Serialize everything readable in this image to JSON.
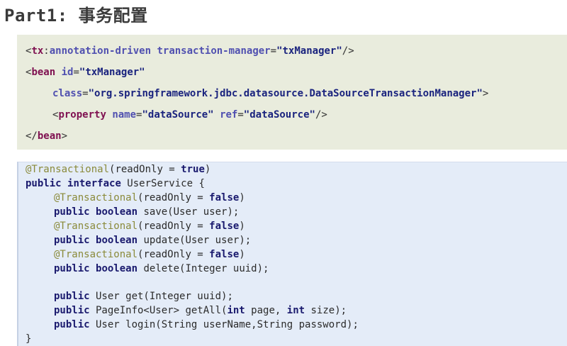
{
  "title": "Part1: 事务配置",
  "xml": {
    "line1": {
      "lt": "<",
      "prefix": "tx",
      "colon": ":",
      "tagname": "annotation-driven",
      "sp": " ",
      "attr": "transaction-manager",
      "eq": "=",
      "val": "\"txManager\"",
      "end": "/>"
    },
    "line2": {
      "lt": "<",
      "tag": "bean",
      "sp": " ",
      "attr": "id",
      "eq": "=",
      "val": "\"txManager\""
    },
    "line3": {
      "attr": "class",
      "eq": "=",
      "val": "\"org.springframework.jdbc.datasource.DataSourceTransactionManager\"",
      "end": ">"
    },
    "line4": {
      "lt": "<",
      "tag": "property",
      "sp": " ",
      "attr1": "name",
      "eq1": "=",
      "val1": "\"dataSource\"",
      "sp2": " ",
      "attr2": "ref",
      "eq2": "=",
      "val2": "\"dataSource\"",
      "end": "/>"
    },
    "line5": {
      "lt": "</",
      "tag": "bean",
      "end": ">"
    }
  },
  "java": {
    "anno": "@Transactional",
    "ro_open": "(readOnly = ",
    "ro_true": "true",
    "ro_false": "false",
    "close_paren": ")",
    "kw_public": "public",
    "kw_interface": "interface",
    "iface_rest": " UserService {",
    "kw_boolean": "boolean",
    "save_sig": " save(User user);",
    "update_sig": " update(User user);",
    "delete_sig": " delete(Integer uuid);",
    "get_sig": " User get(Integer uuid);",
    "getall_pre": " PageInfo<User> getAll(",
    "kw_int": "int",
    "getall_mid": " page, ",
    "getall_end": " size);",
    "login_sig": " User login(String userName,String password);",
    "close_brace": "}"
  }
}
